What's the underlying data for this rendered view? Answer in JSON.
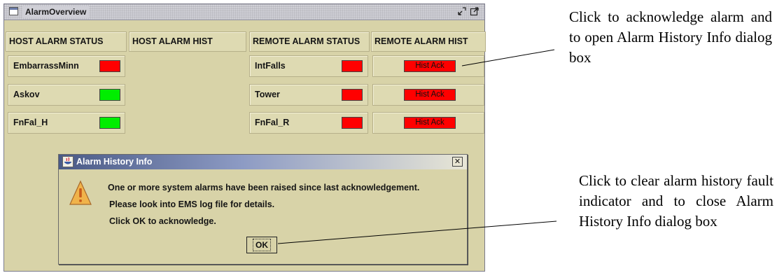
{
  "window": {
    "title": "AlarmOverview",
    "minimize_glyph": "⬋",
    "maximize_glyph": "⤢"
  },
  "columns": {
    "host_status": "HOST ALARM STATUS",
    "host_hist": "HOST ALARM HIST",
    "remote_status": "REMOTE ALARM STATUS",
    "remote_hist": "REMOTE ALARM HIST"
  },
  "host_alarms": [
    {
      "name": "EmbarrassMinn",
      "status": "red"
    },
    {
      "name": "Askov",
      "status": "green"
    },
    {
      "name": "FnFal_H",
      "status": "green"
    }
  ],
  "remote_alarms": [
    {
      "name": "IntFalls",
      "status": "red",
      "hist_label": "Hist Ack"
    },
    {
      "name": "Tower",
      "status": "red",
      "hist_label": "Hist Ack"
    },
    {
      "name": "FnFal_R",
      "status": "red",
      "hist_label": "Hist Ack"
    }
  ],
  "colors": {
    "alarm_red": "#ff0000",
    "ok_green": "#00ee00",
    "panel_bg": "#d8d3a8"
  },
  "dialog": {
    "title": "Alarm History Info",
    "close_glyph": "✕",
    "lines": [
      "One or more system alarms have been raised since last acknowledgement.",
      "Please look into EMS log file for details.",
      "Click OK to acknowledge."
    ],
    "ok_label": "OK",
    "icon": "warning-icon"
  },
  "annotations": {
    "hist_ack": "Click to acknowledge alarm and to open Alarm History Info dialog box",
    "ok": "Click to clear alarm history fault indicator and to close Alarm History Info dialog box"
  }
}
